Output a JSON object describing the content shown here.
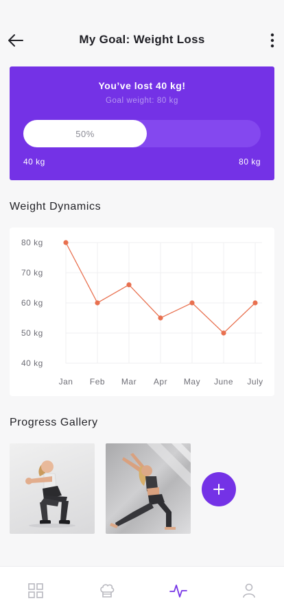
{
  "header": {
    "title": "My Goal: Weight Loss",
    "back_icon": "arrow-left-icon",
    "menu_icon": "more-vertical-icon"
  },
  "goal": {
    "headline": "You’ve lost 40 kg!",
    "subline": "Goal weight: 80 kg",
    "progress_label": "50%",
    "progress_value": 0.5,
    "range_min": "40 kg",
    "range_max": "80 kg",
    "card_color": "#7432e6"
  },
  "weight_dynamics": {
    "section_title": "Weight Dynamics"
  },
  "chart_data": {
    "type": "line",
    "categories": [
      "Jan",
      "Feb",
      "Mar",
      "Apr",
      "May",
      "June",
      "July"
    ],
    "series": [
      {
        "values": [
          80,
          60,
          66,
          55,
          60,
          50,
          60
        ],
        "color": "#e8704f"
      }
    ],
    "y_ticks": [
      "80 kg",
      "70 kg",
      "60 kg",
      "50 kg",
      "40 kg"
    ],
    "ylim": [
      40,
      80
    ],
    "grid": true,
    "title": "",
    "xlabel": "",
    "ylabel": ""
  },
  "gallery": {
    "section_title": "Progress Gallery",
    "photos": [
      {
        "name": "squat-photo"
      },
      {
        "name": "lunge-photo"
      }
    ],
    "add_icon": "plus-icon"
  },
  "bottom_nav": {
    "items": [
      {
        "icon": "grid-icon",
        "active": false
      },
      {
        "icon": "chef-hat-icon",
        "active": false
      },
      {
        "icon": "activity-icon",
        "active": true
      },
      {
        "icon": "user-icon",
        "active": false
      }
    ],
    "active_color": "#7432e6",
    "inactive_color": "#b8b8bf"
  }
}
